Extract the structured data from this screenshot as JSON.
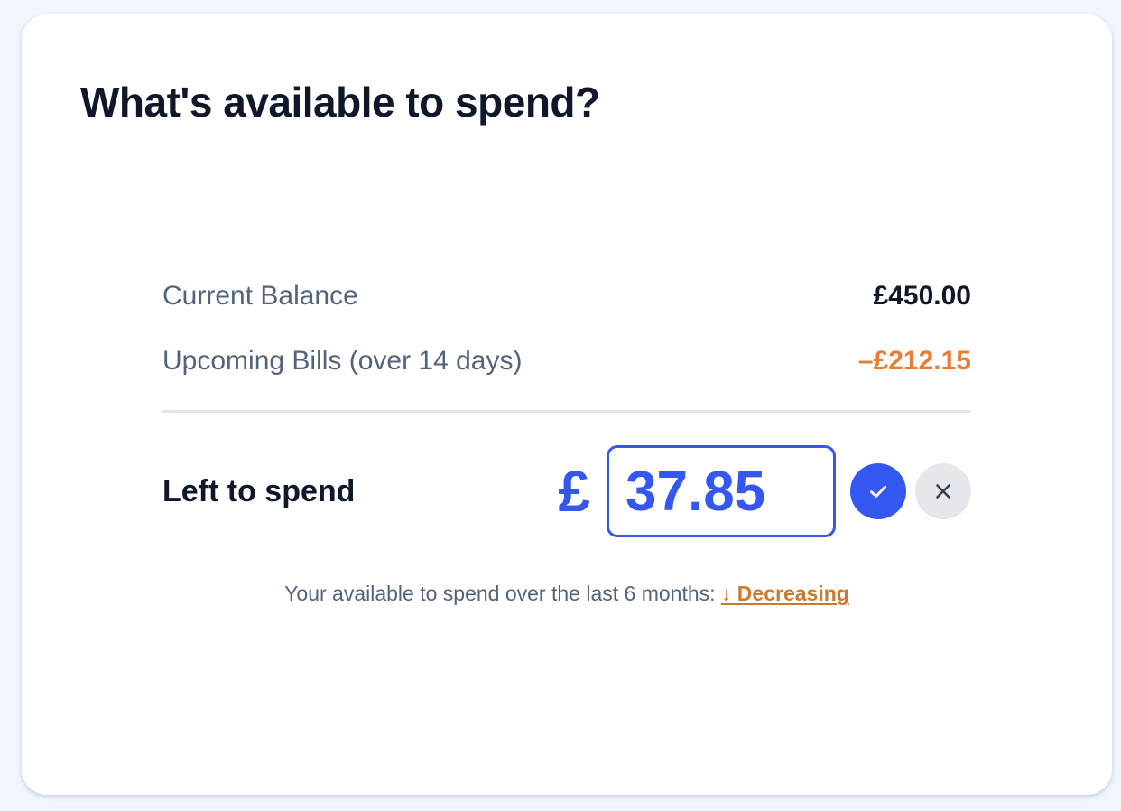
{
  "header": {
    "title": "What's available to spend?"
  },
  "summary": {
    "current_balance": {
      "label": "Current Balance",
      "value": "£450.00"
    },
    "upcoming_bills": {
      "label": "Upcoming Bills (over 14 days)",
      "value": "–£212.15"
    }
  },
  "left_to_spend": {
    "label": "Left to spend",
    "currency": "£",
    "amount": "37.85",
    "confirm_icon": "check-icon",
    "cancel_icon": "close-icon"
  },
  "trend": {
    "text": "Your available to spend over the last 6 months:",
    "arrow": "↓",
    "link_label": "Decreasing"
  },
  "colors": {
    "accent": "#3457f0",
    "negative": "#ea7c33",
    "trend_link": "#cc7a2a",
    "page_background": "#f1f5fd"
  }
}
